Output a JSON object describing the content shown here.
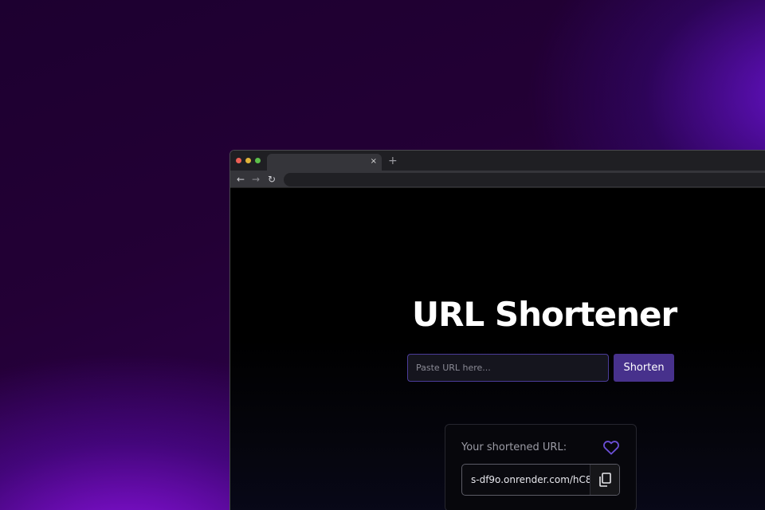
{
  "browser": {
    "tab_close": "×",
    "new_tab": "+",
    "nav": {
      "back": "←",
      "forward": "→",
      "reload": "↻"
    }
  },
  "page": {
    "title": "URL Shortener",
    "input": {
      "placeholder": "Paste URL here...",
      "value": ""
    },
    "shorten_label": "Shorten",
    "result": {
      "label": "Your shortened URL:",
      "short_url": "s-df9o.onrender.com/hC8"
    }
  },
  "icons": {
    "favorite": "heart-icon",
    "copy": "copy-icon"
  },
  "colors": {
    "accent": "#47318c",
    "input_border": "#4b3c9a",
    "heart": "#6b4fd6"
  }
}
